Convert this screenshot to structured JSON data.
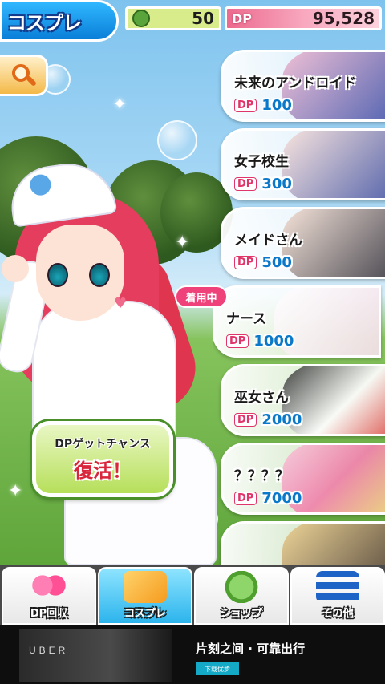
{
  "header": {
    "title": "コスプレ",
    "clover_count": "50",
    "dp_label": "DP",
    "dp_value": "95,528"
  },
  "costumes": [
    {
      "name": "未来のアンドロイド",
      "price": "100",
      "currency": "DP",
      "equipped": false
    },
    {
      "name": "女子校生",
      "price": "300",
      "currency": "DP",
      "equipped": false
    },
    {
      "name": "メイドさん",
      "price": "500",
      "currency": "DP",
      "equipped": false
    },
    {
      "name": "ナース",
      "price": "1000",
      "currency": "DP",
      "equipped": true
    },
    {
      "name": "巫女さん",
      "price": "2000",
      "currency": "DP",
      "equipped": false
    },
    {
      "name": "？？？？",
      "price": "7000",
      "currency": "DP",
      "equipped": false
    }
  ],
  "equipped_badge": "着用中",
  "chance": {
    "title": "DPゲットチャンス",
    "subtitle": "復活！"
  },
  "nav": [
    {
      "label": "DP回収",
      "icon": "hearts-icon"
    },
    {
      "label": "コスプレ",
      "icon": "costume-icon"
    },
    {
      "label": "ショップ",
      "icon": "clover-shop-icon"
    },
    {
      "label": "その他",
      "icon": "menu-list-icon"
    }
  ],
  "ad": {
    "brand": "UBER",
    "headline": "片刻之间 · 可靠出行",
    "cta": "下载优步"
  },
  "colors": {
    "title_tab": "#0a7fd8",
    "dp_bar": "#ec6a8e",
    "clover_bar": "#d9ec8b",
    "price_text": "#0b79c9",
    "equipped_badge": "#f0427a",
    "nav_active": "#2cb4ec"
  }
}
